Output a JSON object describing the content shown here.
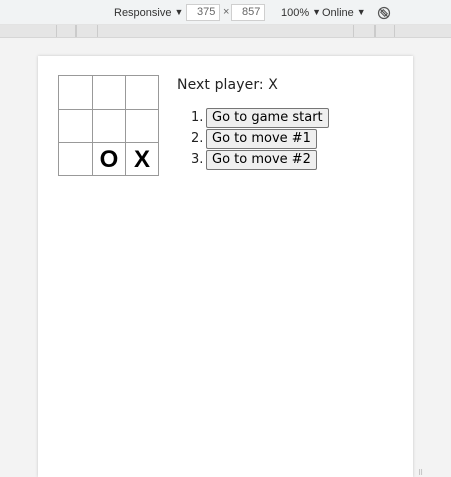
{
  "devtools": {
    "device": "Responsive",
    "width": "375",
    "times": "×",
    "height": "857",
    "zoom": "100%",
    "network": "Online",
    "rotate_icon": "rotate-icon"
  },
  "game": {
    "board": [
      "",
      "",
      "",
      "",
      "",
      "",
      "",
      "O",
      "X"
    ],
    "status": "Next player: X",
    "moves": [
      {
        "num": "1.",
        "label": "Go to game start"
      },
      {
        "num": "2.",
        "label": "Go to move #1"
      },
      {
        "num": "3.",
        "label": "Go to move #2"
      }
    ]
  }
}
